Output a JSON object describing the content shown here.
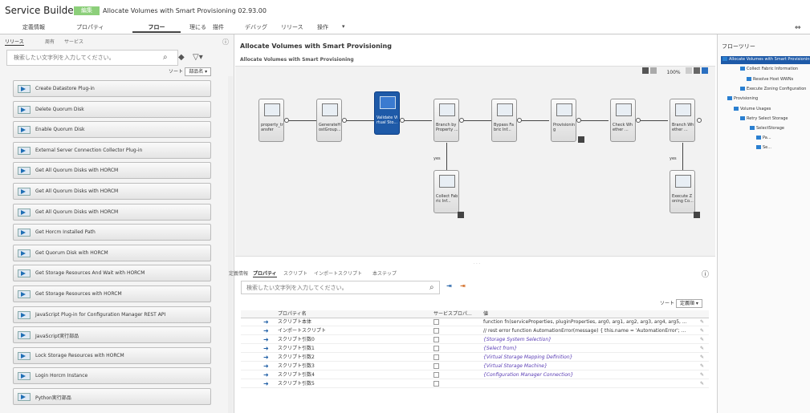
{
  "header": {
    "app_title": "Service Builder",
    "badge": "編集",
    "flow_title": "Allocate Volumes with Smart Provisioning 02.93.00"
  },
  "main_nav": {
    "items": [
      "定義情報",
      "プロパティ",
      "フロー",
      "理にる",
      "描件",
      "デバッグ",
      "リリース",
      "操作"
    ]
  },
  "left_panel": {
    "tabs": [
      "リリース",
      "周有",
      "サービス"
    ],
    "search_placeholder": "検索したい文字列を入力してください。",
    "sort_label": "ソート",
    "sort_value": "部品名",
    "items": [
      "Create Datastore Plug-in",
      "Delete Quorum Disk",
      "Enable Quorum Disk",
      "External Server Connection Collector Plug-in",
      "Get All Quorum Disks with HORCM",
      "Get All Quorum Disks with HORCM",
      "Get All Quorum Disks with HORCM",
      "Get Horcm Installed Path",
      "Get Quorum Disk with HORCM",
      "Get Storage Resources And Wait with HORCM",
      "Get Storage Resources with HORCM",
      "JavaScript Plug-in for Configuration Manager REST API",
      "JavaScript実行部品",
      "Lock Storage Resources with HORCM",
      "Login Horcm Instance",
      "Python実行部品"
    ]
  },
  "flow": {
    "title": "Allocate Volumes with Smart Provisioning",
    "breadcrumb": "Allocate Volumes with Smart Provisioning",
    "zoom": "100%",
    "nodes": [
      "property_transfer",
      "GenerateHostGroup...",
      "Validate Virtual Sto...",
      "Branch by Property ...",
      "Bypass Fabric Inf...",
      "Provisioning",
      "Check Whether ...",
      "Branch Whether ...",
      "Collect Fabric Inf...",
      "Execute Zoning Co..."
    ],
    "yes_label": "yes"
  },
  "bottom": {
    "tabs": [
      "定義情報",
      "プロパティ",
      "スクリプト",
      "インポートスクリプト",
      "本ステップ"
    ],
    "search_placeholder": "検索したい文字列を入力してください。",
    "sort_label": "ソート",
    "sort_value": "定義順",
    "columns": [
      "プロパティ名",
      "サービスプロパ...",
      "値"
    ],
    "rows": [
      {
        "name": "スクリプト本体",
        "value": "function fn(serviceProperties, pluginProperties, arg0, arg1, arg2, arg3, arg4, arg5, ..."
      },
      {
        "name": "インポートスクリプト",
        "value": "// rest error function AutomationError(message) { this.name = 'AutomationError'; ..."
      },
      {
        "name": "スクリプト引数0",
        "value": "{Storage System Selection}"
      },
      {
        "name": "スクリプト引数1",
        "value": "{Select from}"
      },
      {
        "name": "スクリプト引数2",
        "value": "{Virtual Storage Mapping Definition}"
      },
      {
        "name": "スクリプト引数3",
        "value": "{Virtual Storage Machine}"
      },
      {
        "name": "スクリプト引数4",
        "value": "{Configuration Manager Connection}"
      },
      {
        "name": "スクリプト引数5",
        "value": ""
      }
    ]
  },
  "right_panel": {
    "title": "フローツリー",
    "tree": [
      "Allocate Volumes with Smart Provisioning",
      "Collect Fabric Information",
      "Resolve Host WWNs",
      "Execute Zoning Configuration",
      "Provisioning",
      "Volume Usages",
      "Retry Select Storage",
      "SelectStorage",
      "Pa...",
      "Se..."
    ]
  }
}
